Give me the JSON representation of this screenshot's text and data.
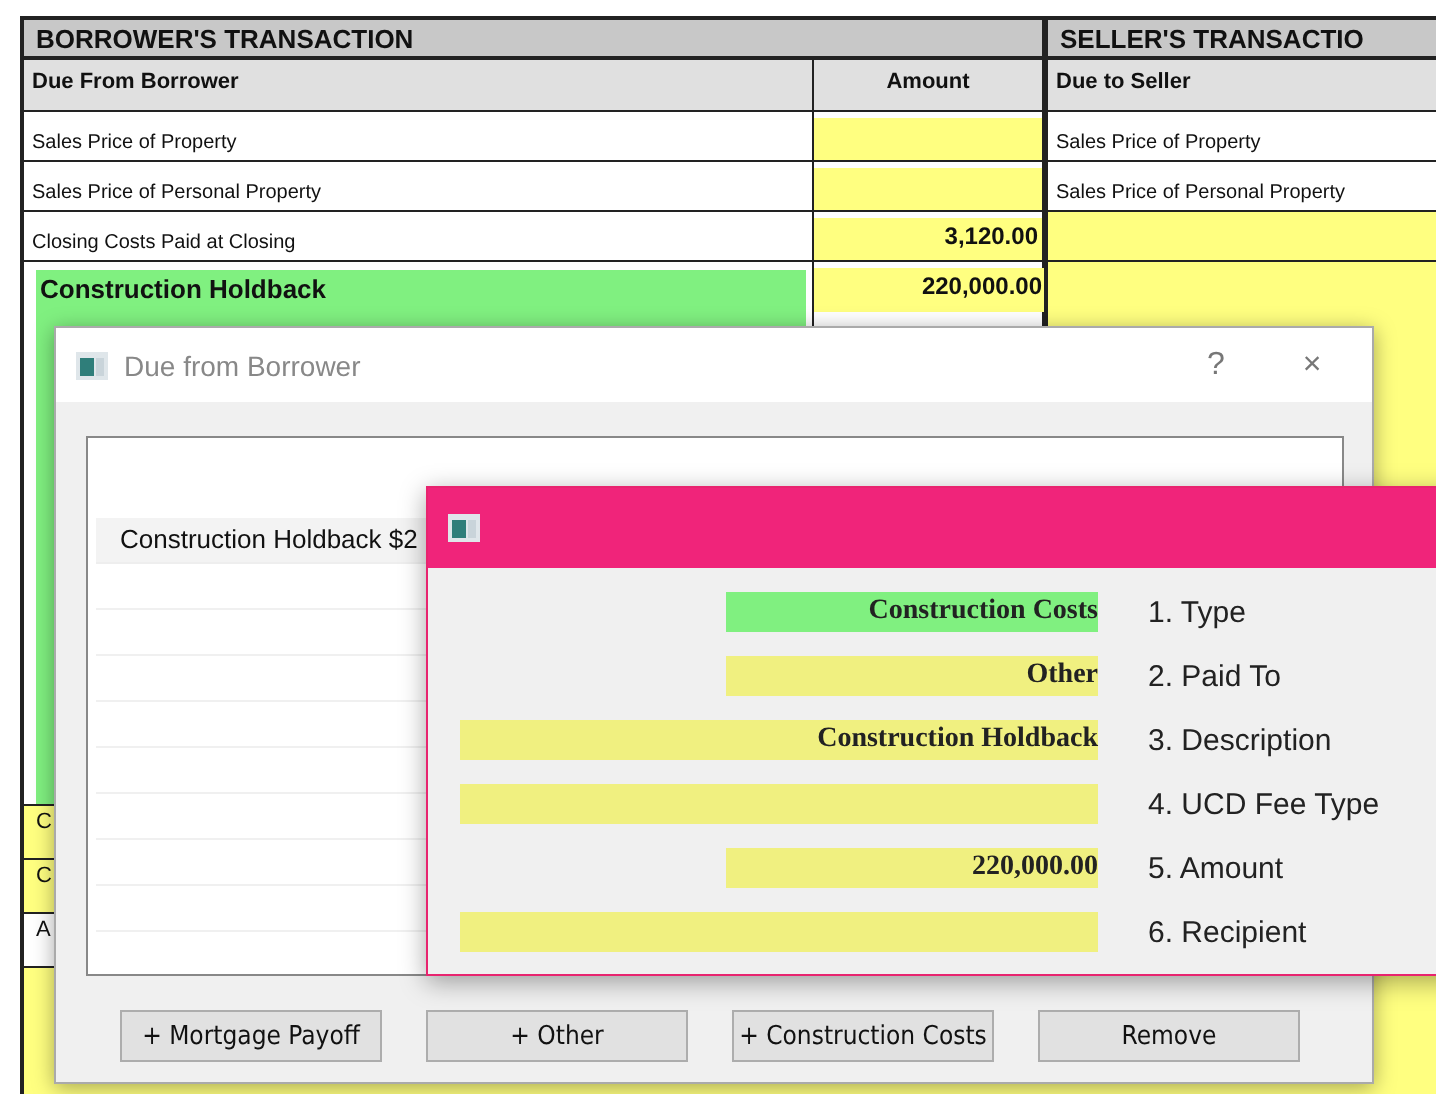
{
  "sheet": {
    "borrower_heading": "BORROWER'S TRANSACTION",
    "seller_heading": "SELLER'S TRANSACTIO",
    "columns": [
      "Due From Borrower",
      "Amount",
      "Due to Seller"
    ],
    "rows": [
      {
        "label": "Sales Price of Property",
        "seller": "Sales Price of Property"
      },
      {
        "label": "Sales Price of Personal Property",
        "seller": "Sales Price of Personal Property"
      },
      {
        "label": "Closing Costs Paid at Closing",
        "amount": "3,120.00"
      },
      {
        "label": "Construction Holdback",
        "amount": "220,000.00",
        "color": "#80f080",
        "kind": "major"
      },
      {
        "label": "C",
        "color": "#ffff80",
        "kind": "fragment"
      },
      {
        "label": "C",
        "color": "#ffff80",
        "kind": "fragment"
      },
      {
        "label": "A",
        "kind": "fragment"
      }
    ]
  },
  "dialog": {
    "title": "Due from Borrower",
    "help": "?",
    "close": "×",
    "list_items": [
      "Construction Holdback $2"
    ],
    "buttons": [
      "+ Mortgage Payoff",
      "+ Other",
      "+ Construction Costs",
      "Remove"
    ]
  },
  "popup": {
    "fields": [
      {
        "value": "Construction Costs",
        "label": "1. Type",
        "color": "#80f080",
        "kind": "short"
      },
      {
        "value": "Other",
        "label": "2. Paid To",
        "color": "#f0f080",
        "kind": "short"
      },
      {
        "value": "Construction Holdback",
        "label": "3. Description",
        "color": "#f0f080",
        "kind": "long"
      },
      {
        "label": "4. UCD Fee Type",
        "color": "#f0f080",
        "kind": "long"
      },
      {
        "value": "220,000.00",
        "label": "5. Amount",
        "color": "#f0f080",
        "kind": "short"
      },
      {
        "label": "6. Recipient",
        "color": "#f0f080",
        "kind": "long"
      }
    ]
  }
}
